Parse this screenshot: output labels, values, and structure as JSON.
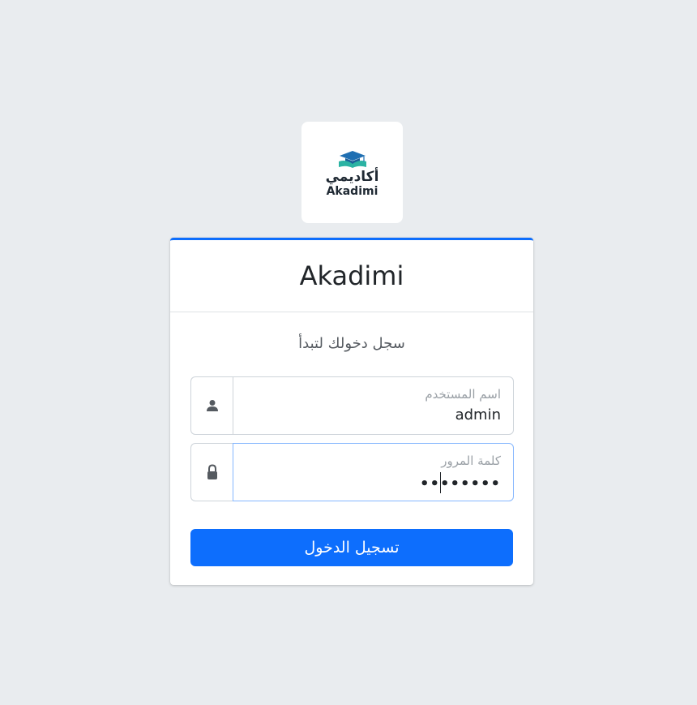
{
  "logo": {
    "text_ar": "أكاديمي",
    "text_en": "Akadimi",
    "cap_color": "#1f6fb2",
    "book_color": "#2bb3a3"
  },
  "card": {
    "title": "Akadimi",
    "subtitle": "سجل دخولك لتبدأ",
    "accent_color": "#0d6efd"
  },
  "form": {
    "username": {
      "label": "اسم المستخدم",
      "value": "admin",
      "icon": "user-icon"
    },
    "password": {
      "label": "كلمة المرور",
      "value": "••••••••",
      "icon": "lock-icon"
    },
    "submit_label": "تسجيل الدخول"
  }
}
